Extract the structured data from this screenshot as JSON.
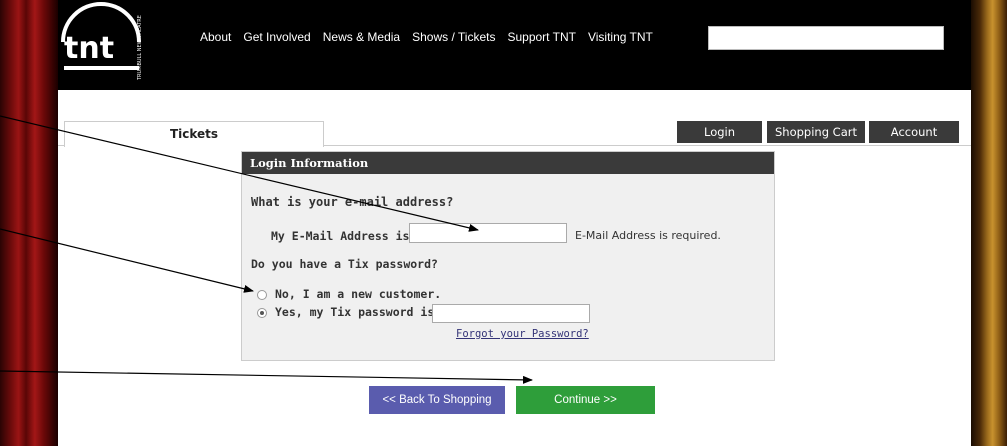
{
  "header": {
    "logo_text": "tnt",
    "logo_side_text": "TRUMBULL NEW THEATRE",
    "nav": [
      "About",
      "Get Involved",
      "News & Media",
      "Shows / Tickets",
      "Support TNT",
      "Visiting TNT"
    ],
    "search": {
      "value": ""
    }
  },
  "tabs": {
    "main": "Tickets",
    "login": "Login",
    "cart": "Shopping Cart",
    "account": "Account"
  },
  "login_box": {
    "title": "Login Information",
    "question_email": "What is your e-mail address?",
    "email_label": "My E-Mail Address is:",
    "email_value": "",
    "email_required": "E-Mail Address is required.",
    "question_password": "Do you have a Tix password?",
    "option_new": "No, I am a new customer.",
    "option_existing": "Yes, my Tix password is:",
    "password_value": "",
    "forgot_link": "Forgot your Password?",
    "selected_option": "existing"
  },
  "buttons": {
    "back": "<< Back To Shopping",
    "continue": "Continue >>"
  },
  "colors": {
    "header_bg": "#000000",
    "tab_dark": "#3a3a3a",
    "back_button": "#5a5cae",
    "continue_button": "#2e9e3a"
  }
}
